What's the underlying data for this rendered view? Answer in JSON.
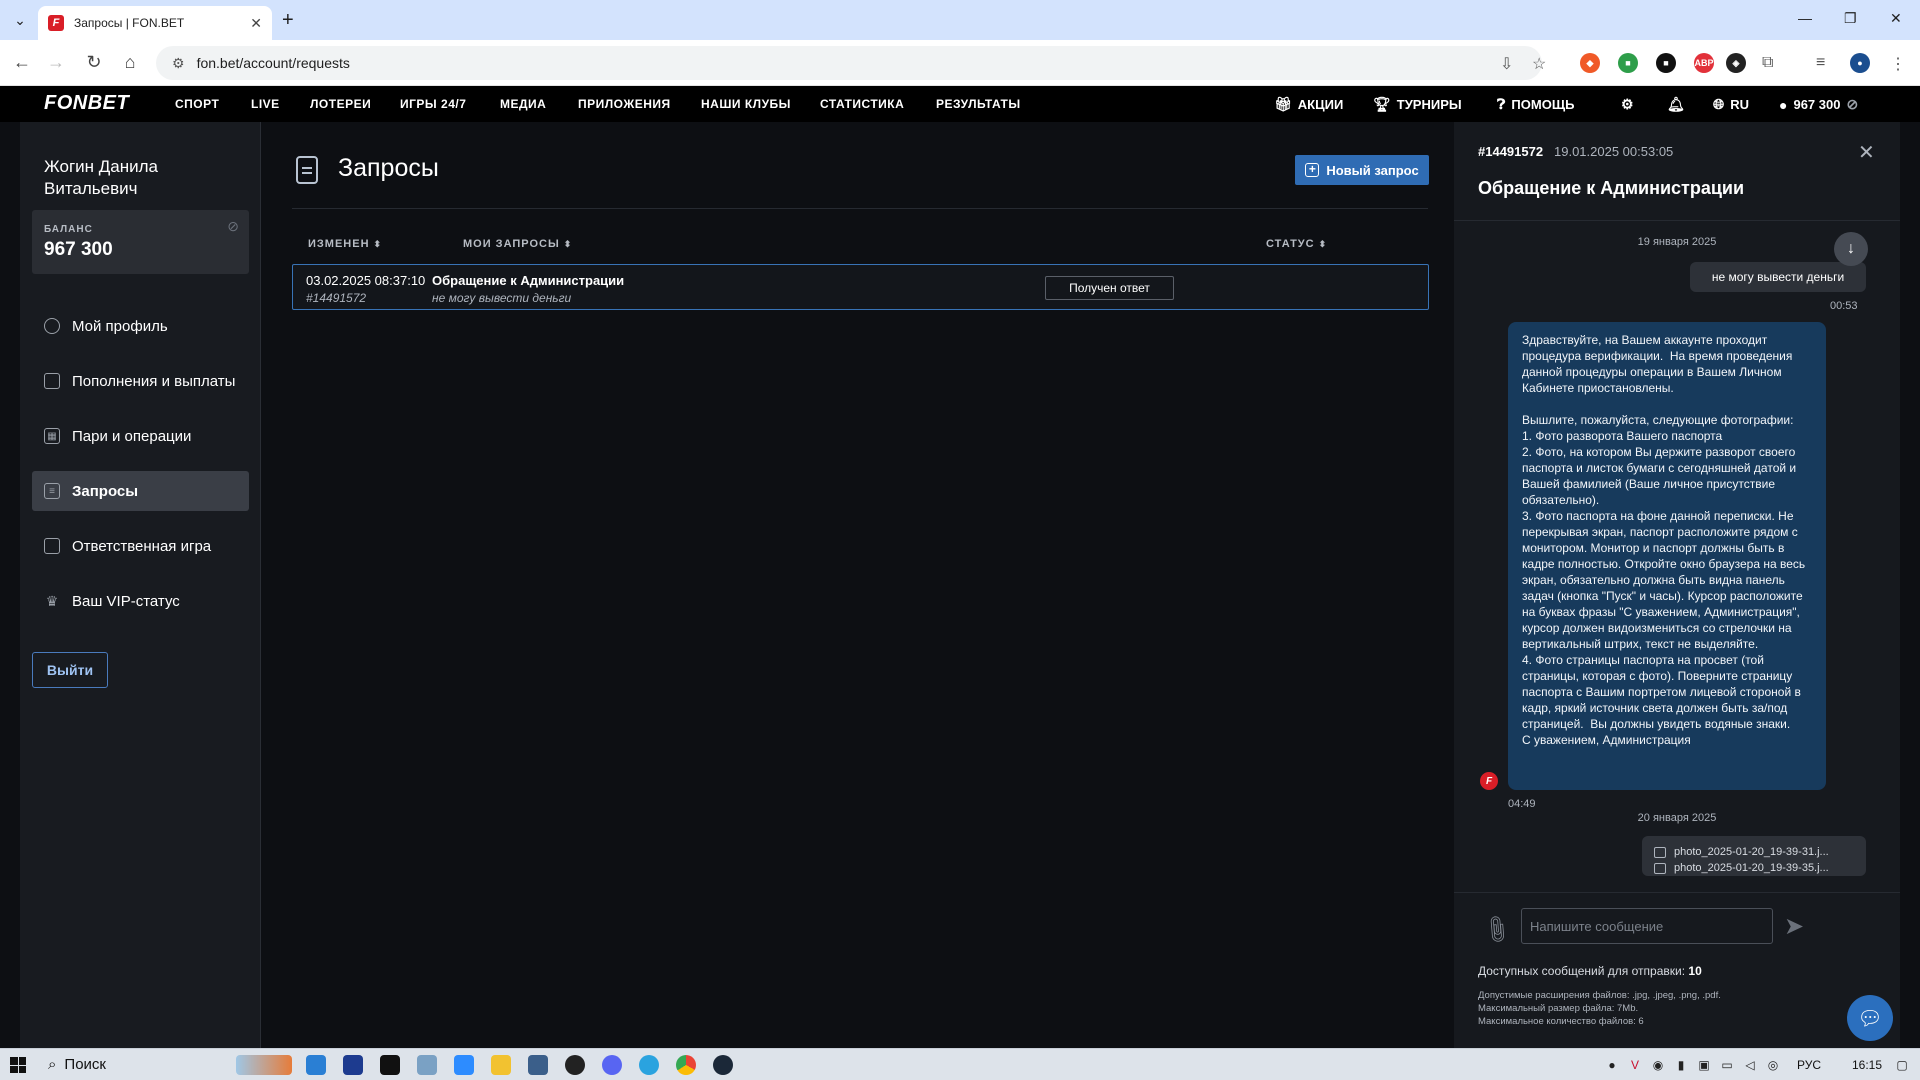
{
  "browser": {
    "tab_title": "Запросы | FON.BET",
    "url": "fon.bet/account/requests"
  },
  "site": {
    "logo": "FONBET",
    "nav": [
      "СПОРТ",
      "LIVE",
      "ЛОТЕРЕИ",
      "ИГРЫ 24/7",
      "МЕДИА",
      "ПРИЛОЖЕНИЯ",
      "НАШИ КЛУБЫ",
      "СТАТИСТИКА",
      "РЕЗУЛЬТАТЫ"
    ],
    "promo": "АКЦИИ",
    "tournaments": "ТУРНИРЫ",
    "help": "ПОМОЩЬ",
    "lang": "RU",
    "balance": "967 300"
  },
  "sidebar": {
    "user_name": "Жогин Данила Витальевич",
    "balance_label": "БАЛАНС",
    "balance_value": "967 300",
    "items": [
      {
        "label": "Мой профиль",
        "icon": "user-icon"
      },
      {
        "label": "Пополнения и выплаты",
        "icon": "wallet-icon"
      },
      {
        "label": "Пари и операции",
        "icon": "grid-icon"
      },
      {
        "label": "Запросы",
        "icon": "document-icon"
      },
      {
        "label": "Ответственная игра",
        "icon": "lock-icon"
      },
      {
        "label": "Ваш VIP-статус",
        "icon": "crown-icon"
      }
    ],
    "logout": "Выйти"
  },
  "main": {
    "title": "Запросы",
    "new_request": "Новый запрос",
    "columns": {
      "changed": "ИЗМЕНЕН",
      "requests": "МОИ ЗАПРОСЫ",
      "status": "СТАТУС"
    },
    "rows": [
      {
        "date": "03.02.2025 08:37:10",
        "number": "#14491572",
        "subject": "Обращение к Администрации",
        "snippet": "не могу вывести деньги",
        "status": "Получен ответ"
      }
    ]
  },
  "panel": {
    "ticket_no": "#14491572",
    "ticket_datetime": "19.01.2025 00:53:05",
    "title": "Обращение к Администрации",
    "day1": "19 января 2025",
    "user_msg": "не могу вывести деньги",
    "user_time": "00:53",
    "admin_msg": "Здравствуйте, на Вашем аккаунте проходит процедура верификации.  На время проведения данной процедуры операции в Вашем Личном Кабинете приостановлены.\n\nВышлите, пожалуйста, следующие фотографии:\n1. Фото разворота Вашего паспорта\n2. Фото, на котором Вы держите разворот своего паспорта и листок бумаги с сегодняшней датой и Вашей фамилией (Ваше личное присутствие обязательно).\n3. Фото паспорта на фоне данной переписки. Не перекрывая экран, паспорт расположите рядом с монитором. Монитор и паспорт должны быть в кадре полностью. Откройте окно браузера на весь экран, обязательно должна быть видна панель задач (кнопка \"Пуск\" и часы). Курсор расположите на буквах фразы \"С уважением, Администрация\", курсор должен видоизмениться со стрелочки на вертикальный штрих, текст не выделяйте.\n4. Фото страницы паспорта на просвет (той страницы, которая с фото). Поверните страницу паспорта с Вашим портретом лицевой стороной в кадр, яркий источник света должен быть за/под страницей.  Вы должны увидеть водяные знаки.\nС уважением, Администрация",
    "admin_time": "04:49",
    "day2": "20 января 2025",
    "files": [
      "photo_2025-01-20_19-39-31.j...",
      "photo_2025-01-20_19-39-35.j..."
    ],
    "input_placeholder": "Напишите сообщение",
    "avail_label": "Доступных сообщений для отправки:",
    "avail_count": "10",
    "rule1": "Допустимые расширения файлов: .jpg, .jpeg, .png, .pdf.",
    "rule2": "Максимальный размер файла: 7Mb.",
    "rule3": "Максимальное количество файлов: 6"
  },
  "taskbar": {
    "search": "Поиск",
    "lang": "РУС",
    "time": "16:15"
  }
}
